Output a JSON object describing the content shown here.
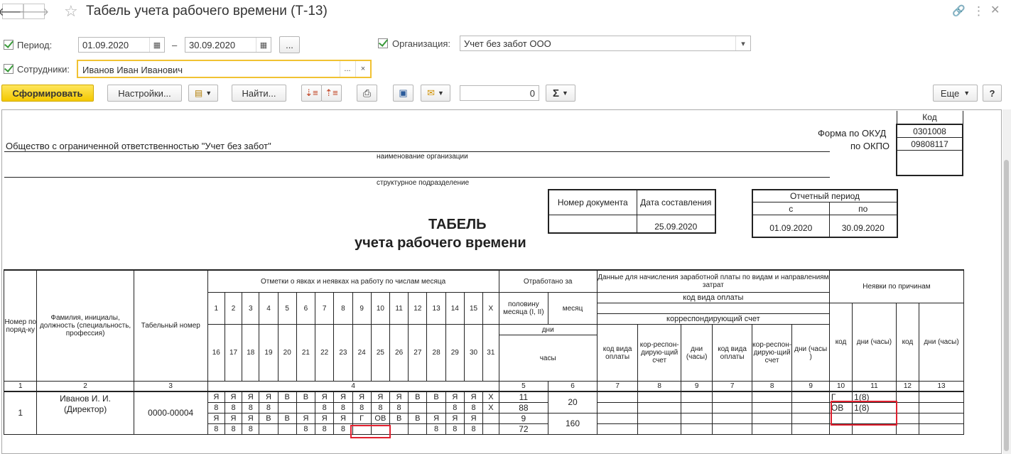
{
  "window": {
    "title": "Табель учета рабочего времени (Т-13)"
  },
  "filters": {
    "period_label": "Период:",
    "date_from": "01.09.2020",
    "dash": "–",
    "date_to": "30.09.2020",
    "dots": "...",
    "org_label": "Организация:",
    "org_value": "Учет без забот ООО",
    "emp_label": "Сотрудники:",
    "emp_value": "Иванов Иван Иванович",
    "clear": "×"
  },
  "toolbar": {
    "generate": "Сформировать",
    "settings": "Настройки...",
    "find": "Найти...",
    "sum_value": "0",
    "sigma": "Σ",
    "more": "Еще",
    "help": "?"
  },
  "report": {
    "org_name": "Общество с ограниченной ответственностью \"Учет без забот\"",
    "org_caption": "наименование организации",
    "dept_caption": "структурное подразделение",
    "code_header": "Код",
    "okud_label": "Форма по ОКУД",
    "okud_value": "0301008",
    "okpo_label": "по ОКПО",
    "okpo_value": "09808117",
    "doc_number_header": "Номер документа",
    "doc_date_header": "Дата составления",
    "doc_number": "",
    "doc_date": "25.09.2020",
    "period_header": "Отчетный период",
    "period_from_label": "с",
    "period_to_label": "по",
    "period_from": "01.09.2020",
    "period_to": "30.09.2020",
    "title1": "ТАБЕЛЬ",
    "title2": "учета  рабочего времени"
  },
  "table": {
    "h_num": "Номер по поряд-ку",
    "h_name": "Фамилия, инициалы, должность (специальность, профессия)",
    "h_tab": "Табельный номер",
    "h_marks": "Отметки о явках и неявках на работу по числам месяца",
    "h_worked": "Отработано за",
    "h_half": "половину месяца (I, II)",
    "h_month": "месяц",
    "h_days": "дни",
    "h_hours": "часы",
    "h_pay": "Данные для начисления заработной платы по видам и направлениям затрат",
    "h_paycode": "код вида оплаты",
    "h_corr": "корреспондирующий счет",
    "h_kvo": "код вида оплаты",
    "h_kss": "кор-респон-дирую-щий счет",
    "h_dh": "дни (часы)",
    "h_dh2": "дни (часы )",
    "h_absent": "Неявки по причинам",
    "h_code": "код",
    "h_days_hours": "дни (часы)",
    "days1": [
      "1",
      "2",
      "3",
      "4",
      "5",
      "6",
      "7",
      "8",
      "9",
      "10",
      "11",
      "12",
      "13",
      "14",
      "15",
      "X"
    ],
    "days2": [
      "16",
      "17",
      "18",
      "19",
      "20",
      "21",
      "22",
      "23",
      "24",
      "25",
      "26",
      "27",
      "28",
      "29",
      "30",
      "31"
    ],
    "colnums": [
      "1",
      "2",
      "3",
      "4",
      "5",
      "6",
      "7",
      "8",
      "9",
      "7",
      "8",
      "9",
      "10",
      "11",
      "12",
      "13"
    ],
    "employee": {
      "num": "1",
      "name": "Иванов И. И. (Директор)",
      "tab": "0000-00004",
      "r1": [
        "Я",
        "Я",
        "Я",
        "Я",
        "В",
        "В",
        "Я",
        "Я",
        "Я",
        "Я",
        "Я",
        "В",
        "В",
        "Я",
        "Я",
        "X"
      ],
      "r2": [
        "8",
        "8",
        "8",
        "8",
        "",
        "",
        "8",
        "8",
        "8",
        "8",
        "8",
        "",
        "",
        "8",
        "8",
        "X"
      ],
      "r3": [
        "Я",
        "Я",
        "Я",
        "В",
        "В",
        "Я",
        "Я",
        "Я",
        "Г",
        "ОВ",
        "В",
        "В",
        "Я",
        "Я",
        "Я",
        ""
      ],
      "r4": [
        "8",
        "8",
        "8",
        "",
        "",
        "8",
        "8",
        "8",
        "",
        "",
        "",
        "",
        "8",
        "8",
        "8",
        ""
      ],
      "half1_days": "11",
      "half1_hours": "88",
      "half2_days": "9",
      "half2_hours": "72",
      "month_days": "20",
      "month_hours": "160",
      "abs1_code": "Г",
      "abs1_days": "1(8)",
      "abs2_code": "ОВ",
      "abs2_days": "1(8)"
    }
  }
}
